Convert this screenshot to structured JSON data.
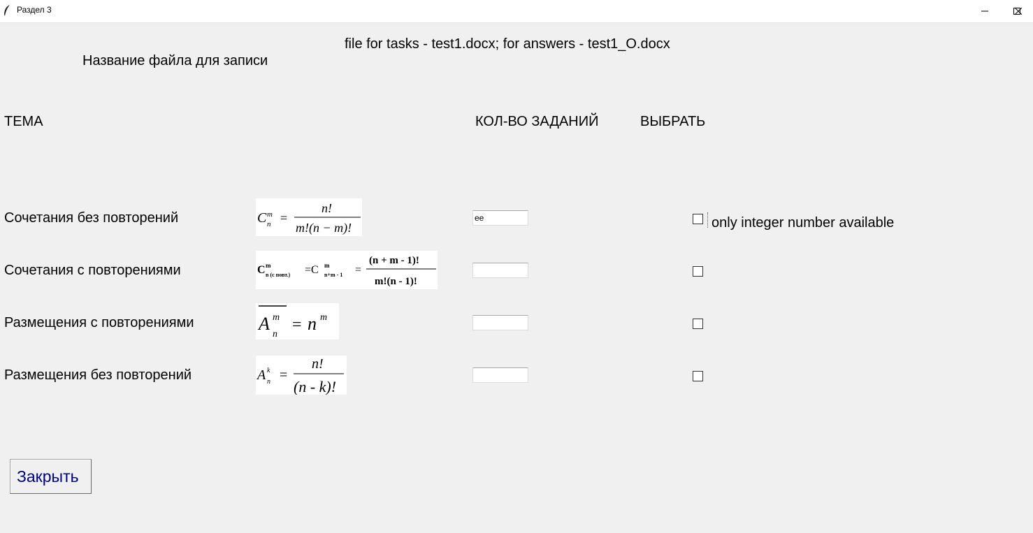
{
  "window": {
    "title": "Раздел 3",
    "app_icon": "feather-icon",
    "controls": [
      "minimize-icon",
      "maximize-icon",
      "close-icon"
    ]
  },
  "header": {
    "file_info": "file for tasks - test1.docx; for answers - test1_O.docx",
    "filename_label": "Название файла для записи"
  },
  "columns": {
    "topic": "ТЕМА",
    "count": "КОЛ-ВО ЗАДАНИЙ",
    "select": "ВЫБРАТЬ"
  },
  "rows": [
    {
      "topic": "Сочетания без повторений",
      "count_value": "ee",
      "checked": false
    },
    {
      "topic": "Сочетания с повторениями",
      "count_value": "",
      "checked": false
    },
    {
      "topic": "Размещения с повторениями",
      "count_value": "",
      "checked": false
    },
    {
      "topic": "Размещения без повторений",
      "count_value": "",
      "checked": false
    }
  ],
  "validation_message": "only integer number available",
  "close_button": "Закрыть"
}
